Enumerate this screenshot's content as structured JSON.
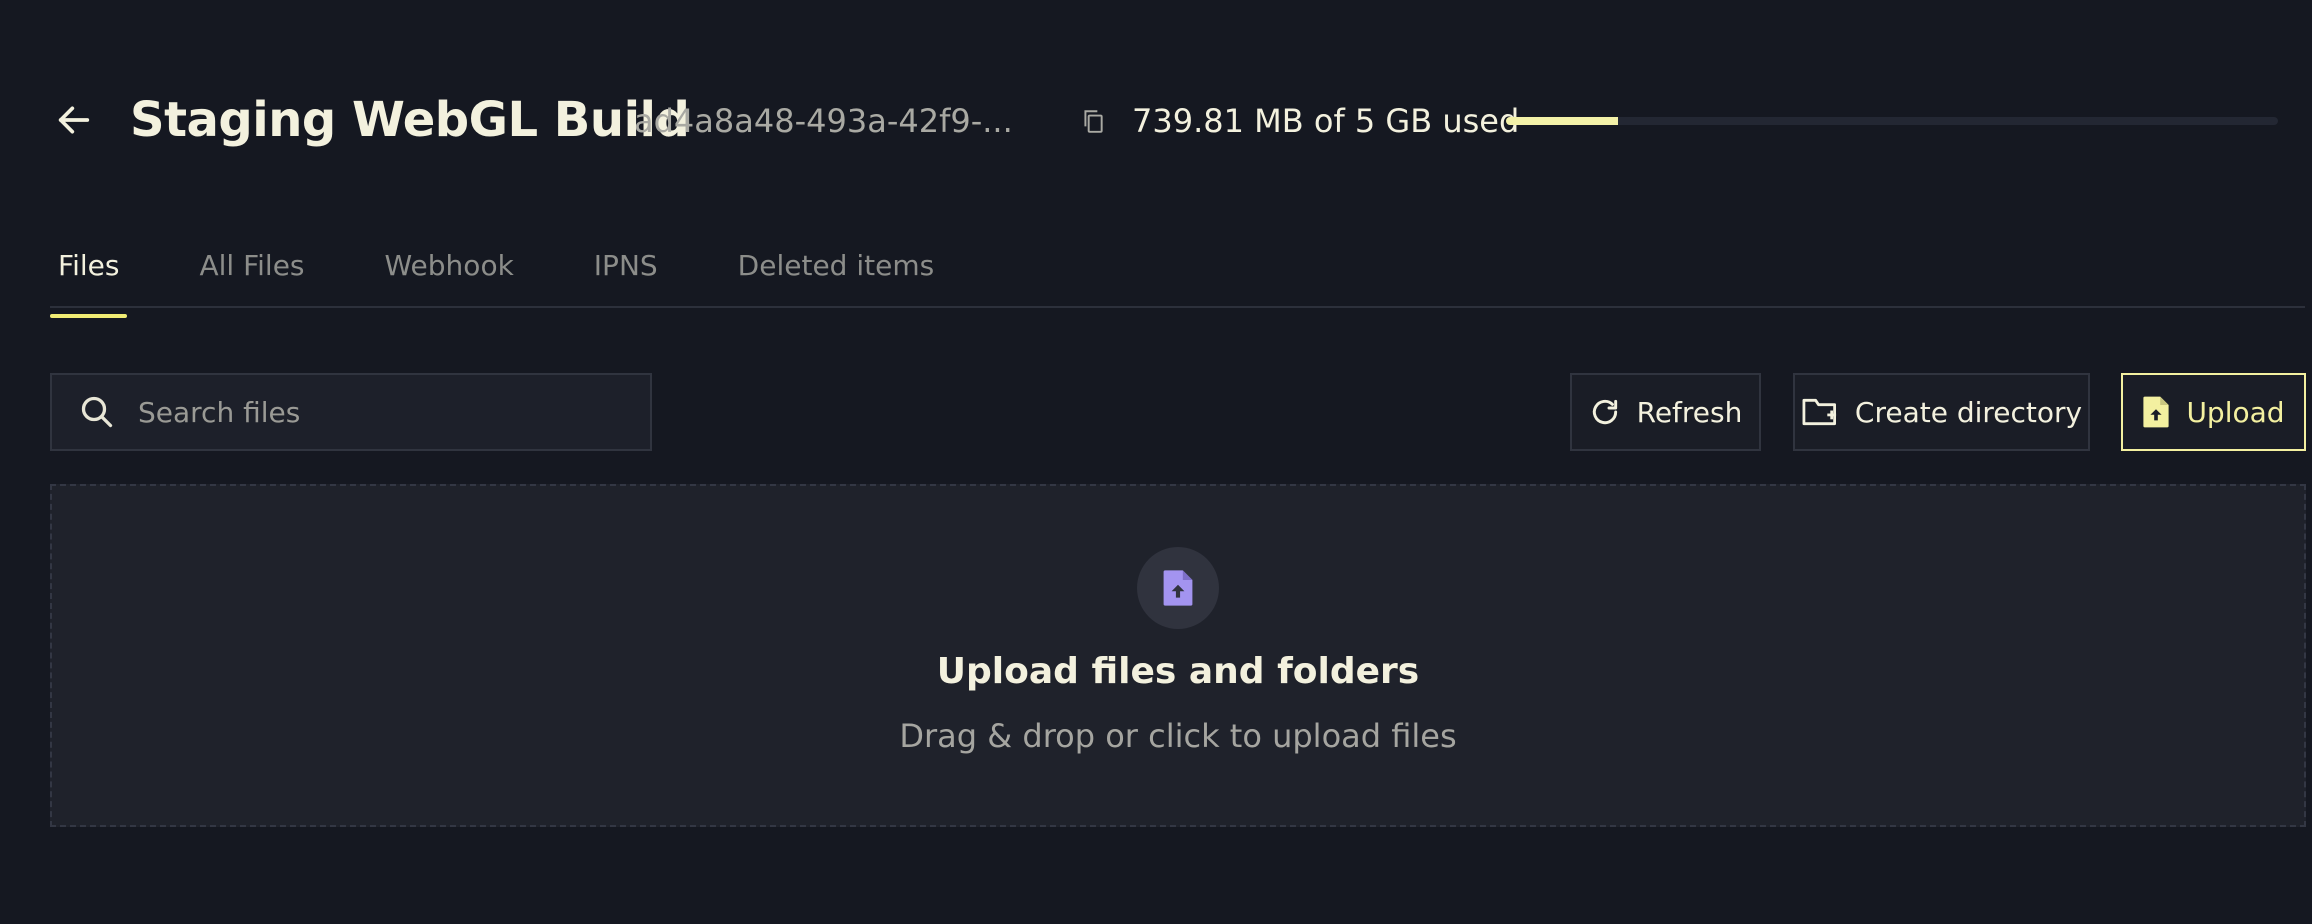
{
  "header": {
    "back_icon": "arrow-left-icon",
    "title": "Staging WebGL Build",
    "bucket_id": "ad4a8a48-493a-42f9-...",
    "storage_icon": "copy-icon",
    "storage_text": "739.81 MB of 5 GB used",
    "storage_used_fraction": 0.1445
  },
  "tabs": [
    {
      "label": "Files",
      "active": true
    },
    {
      "label": "All Files",
      "active": false
    },
    {
      "label": "Webhook",
      "active": false
    },
    {
      "label": "IPNS",
      "active": false
    },
    {
      "label": "Deleted items",
      "active": false
    }
  ],
  "search": {
    "icon": "search-icon",
    "placeholder": "Search files",
    "value": ""
  },
  "toolbar": {
    "refresh_label": "Refresh",
    "refresh_icon": "refresh-icon",
    "create_directory_label": "Create directory",
    "create_directory_icon": "folder-plus-icon",
    "upload_label": "Upload",
    "upload_icon": "file-upload-icon"
  },
  "dropzone": {
    "icon": "file-upload-icon",
    "title": "Upload files and folders",
    "subtitle": "Drag & drop or click to upload files"
  },
  "colors": {
    "background": "#151821",
    "accent": "#f3f0a0",
    "dropzone_icon": "#a394f0"
  }
}
